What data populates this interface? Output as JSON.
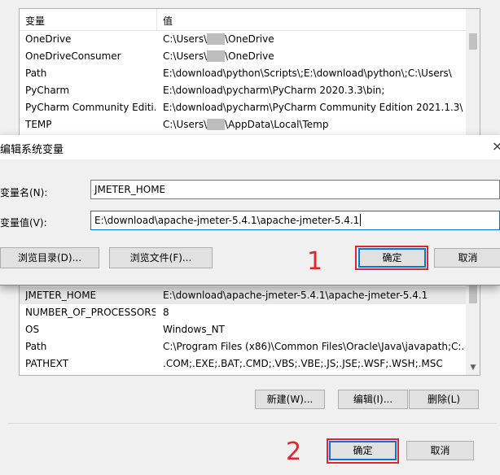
{
  "top_list": {
    "header_var": "变量",
    "header_val": "值",
    "rows": [
      {
        "name": "OneDrive",
        "value_pre": "C:\\Users\\",
        "value_post": "\\OneDrive",
        "masked": true
      },
      {
        "name": "OneDriveConsumer",
        "value_pre": "C:\\Users\\",
        "value_post": "\\OneDrive",
        "masked": true
      },
      {
        "name": "Path",
        "value": "E:\\download\\python\\Scripts\\;E:\\download\\python\\;C:\\Users\\"
      },
      {
        "name": "PyCharm",
        "value": "E:\\download\\pycharm\\PyCharm 2020.3.3\\bin;"
      },
      {
        "name": "PyCharm Community Editi...",
        "value": "E:\\download\\pycharm\\PyCharm Community Edition 2021.1.3\\"
      },
      {
        "name": "TEMP",
        "value_pre": "C:\\Users\\",
        "value_post": "\\AppData\\Local\\Temp",
        "masked": true
      }
    ]
  },
  "dialog": {
    "title": "编辑系统变量",
    "close": "×",
    "name_label": "变量名(N):",
    "value_label": "变量值(V):",
    "name_value": "JMETER_HOME",
    "value_value": "E:\\download\\apache-jmeter-5.4.1\\apache-jmeter-5.4.1",
    "browse_dir": "浏览目录(D)...",
    "browse_file": "浏览文件(F)...",
    "ok": "确定",
    "cancel": "取消"
  },
  "bottom_list": {
    "partial_top": "...",
    "rows": [
      {
        "name": "JMETER_HOME",
        "value": "E:\\download\\apache-jmeter-5.4.1\\apache-jmeter-5.4.1",
        "selected": true
      },
      {
        "name": "NUMBER_OF_PROCESSORS",
        "value": "8"
      },
      {
        "name": "OS",
        "value": "Windows_NT"
      },
      {
        "name": "Path",
        "value": "C:\\Program Files (x86)\\Common Files\\Oracle\\Java\\javapath;C:..."
      },
      {
        "name": "PATHEXT",
        "value": ".COM;.EXE;.BAT;.CMD;.VBS;.VBE;.JS;.JSE;.WSF;.WSH;.MSC"
      }
    ],
    "new_button": "新建(W)...",
    "edit_button": "编辑(I)...",
    "delete_button": "删除(L)"
  },
  "footer": {
    "ok": "确定",
    "cancel": "取消"
  },
  "annotations": {
    "step1": "1",
    "step2": "2",
    "color": "#e0262a"
  }
}
